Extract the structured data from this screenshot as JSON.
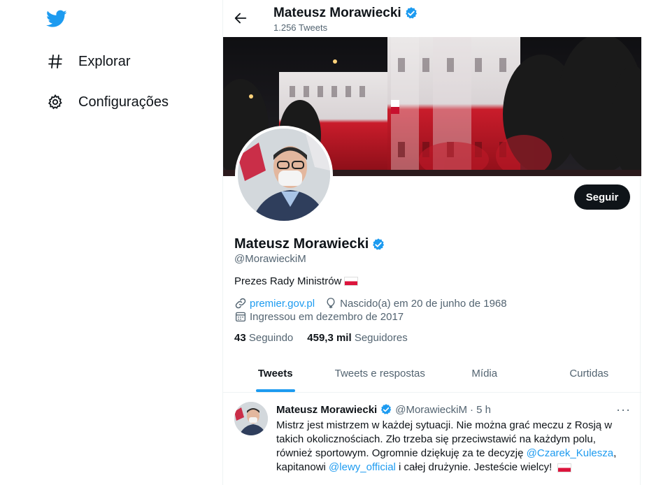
{
  "nav": {
    "logo": "twitter-bird-icon",
    "items": [
      {
        "label": "Explorar",
        "icon": "hashtag-icon"
      },
      {
        "label": "Configurações",
        "icon": "gear-icon"
      }
    ]
  },
  "header": {
    "name": "Mateusz Morawiecki",
    "tweet_count": "1.256 Tweets"
  },
  "profile": {
    "name": "Mateusz Morawiecki",
    "handle": "@MorawieckiM",
    "bio": "Prezes Rady Ministrów",
    "website": "premier.gov.pl",
    "birth": "Nascido(a) em 20 de junho de 1968",
    "joined": "Ingressou em dezembro de 2017",
    "following_count": "43",
    "following_label": "Seguindo",
    "followers_count": "459,3 mil",
    "followers_label": "Seguidores",
    "follow_button": "Seguir"
  },
  "tabs": [
    {
      "label": "Tweets",
      "active": true
    },
    {
      "label": "Tweets e respostas",
      "active": false
    },
    {
      "label": "Mídia",
      "active": false
    },
    {
      "label": "Curtidas",
      "active": false
    }
  ],
  "tweet": {
    "author": "Mateusz Morawiecki",
    "handle": "@MorawieckiM",
    "time": "· 5 h",
    "more": "···",
    "text_1": "Mistrz jest mistrzem w każdej sytuacji. Nie można grać meczu z Rosją w takich okolicznościach. Zło trzeba się przeciwstawić na każdym polu, również sportowym. Ogromnie dziękuję za te decyzję ",
    "mention_1": "@Czarek_Kulesza",
    "text_2": ", kapitanowi ",
    "mention_2": "@lewy_official",
    "text_3": " i całej drużynie. Jesteście wielcy!"
  },
  "colors": {
    "accent": "#1d9bf0",
    "text": "#0f1419",
    "muted": "#536471"
  }
}
